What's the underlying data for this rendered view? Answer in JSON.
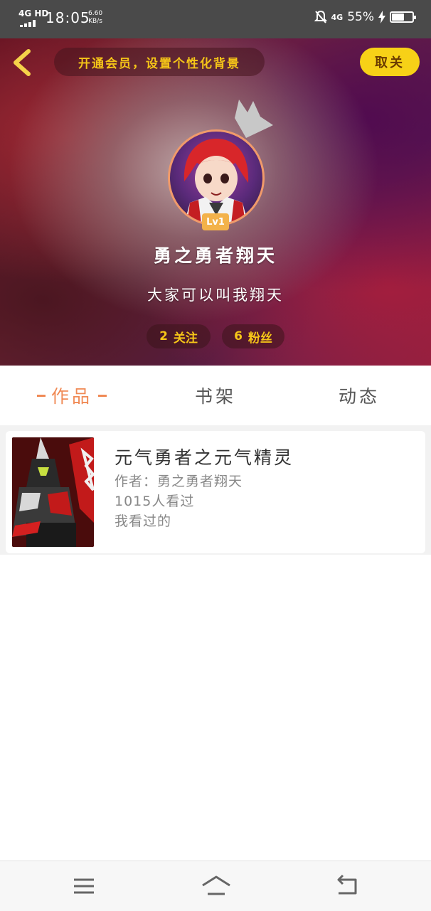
{
  "status_bar": {
    "network": "4G HD",
    "time": "18:05",
    "speed_value": "6.60",
    "speed_unit": "KB/s",
    "network_right": "4G",
    "battery": "55%"
  },
  "header": {
    "vip_text": "开通会员，设置个性化背景",
    "cancel_label": "取关"
  },
  "profile": {
    "level": "Lv1",
    "nickname": "勇之勇者翔天",
    "signature": "大家可以叫我翔天",
    "following_count": "2",
    "following_label": "关注",
    "fans_count": "6",
    "fans_label": "粉丝"
  },
  "tabs": [
    {
      "label": "作品"
    },
    {
      "label": "书架"
    },
    {
      "label": "动态"
    }
  ],
  "works": [
    {
      "title": "元气勇者之元气精灵",
      "author": "作者：勇之勇者翔天",
      "views": "1015人看过",
      "note": "我看过的"
    }
  ],
  "colors": {
    "accent": "#f08a55",
    "vip_yellow": "#f5c518",
    "button_yellow": "#f7d117"
  }
}
